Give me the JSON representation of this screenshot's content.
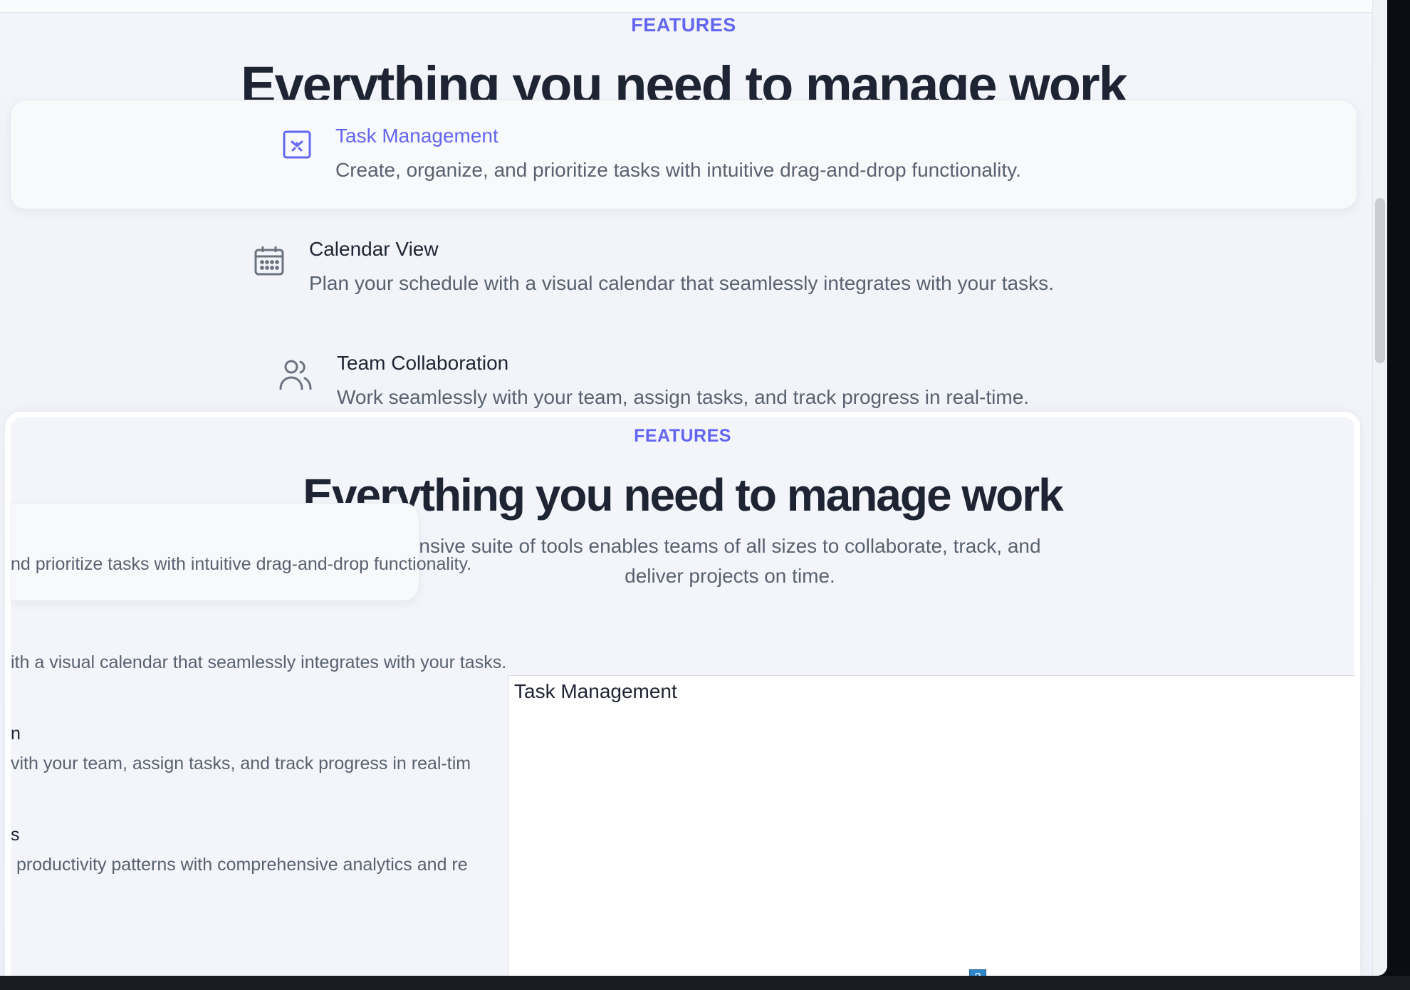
{
  "section": {
    "eyebrow": "FEATURES",
    "headline": "Everything you need to manage work"
  },
  "features": [
    {
      "title": "Task Management",
      "desc": "Create, organize, and prioritize tasks with intuitive drag-and-drop functionality.",
      "icon": "task-icon"
    },
    {
      "title": "Calendar View",
      "desc": "Plan your schedule with a visual calendar that seamlessly integrates with your tasks.",
      "icon": "calendar-icon"
    },
    {
      "title": "Team Collaboration",
      "desc": "Work seamlessly with your team, assign tasks, and track progress in real-time.",
      "icon": "users-icon"
    }
  ],
  "overlay": {
    "eyebrow": "FEATURES",
    "headline": "Everything you need to manage work",
    "subtitle_line1": "nsive suite of tools enables teams of all sizes to collaborate, track, and",
    "subtitle_line2": "deliver projects on time.",
    "frag_task_desc": "nd prioritize tasks with intuitive drag-and-drop functionality.",
    "frag_calendar_desc": "ith a visual calendar that seamlessly integrates with your tasks.",
    "frag_team_title": "n",
    "frag_team_desc": "vith your team, assign tasks, and track progress in real-tim",
    "frag_analytics_title": "s",
    "frag_analytics_desc": "productivity patterns with comprehensive analytics and re",
    "preview_title": "Task Management",
    "help_badge": "?"
  },
  "colors": {
    "accent": "#6366f1",
    "heading": "#1e2433",
    "body_text": "#596170"
  }
}
